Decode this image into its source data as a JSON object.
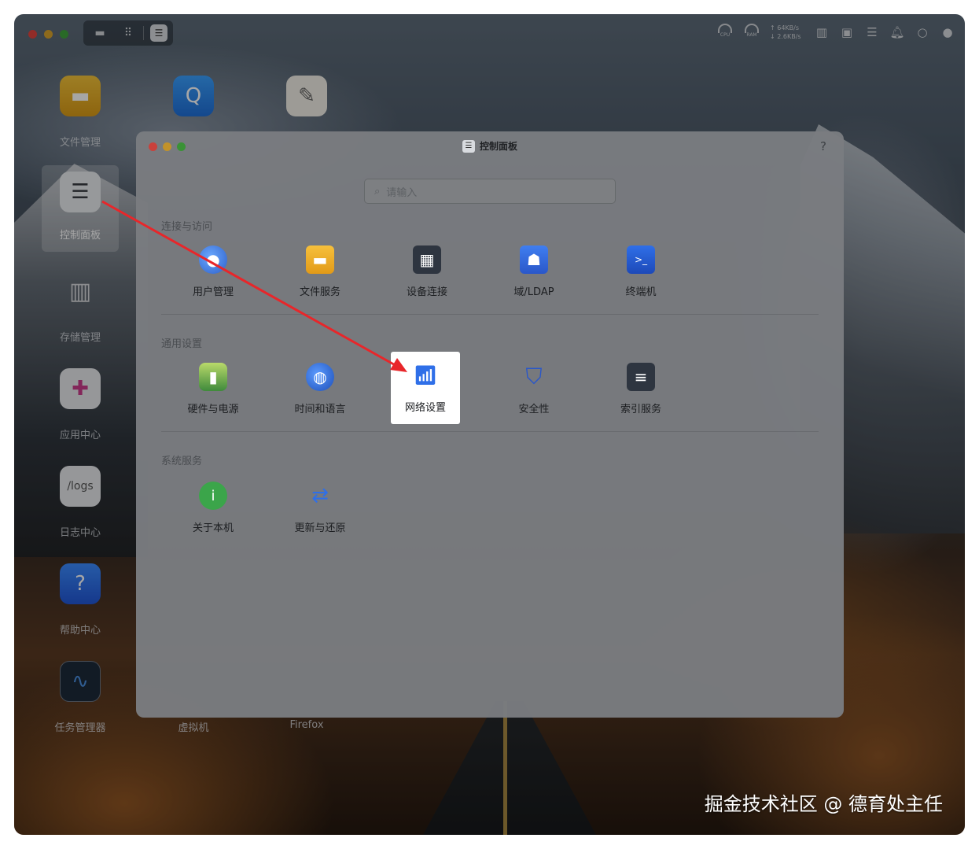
{
  "topbar": {
    "cpu_label": "CPU",
    "ram_label": "RAM",
    "upload": "↑ 64KB/s",
    "download": "↓ 2.6KB/s"
  },
  "desktop": {
    "icons": [
      {
        "label": "文件管理"
      },
      {
        "label": "控制面板"
      },
      {
        "label": "存储管理"
      },
      {
        "label": "应用中心"
      },
      {
        "label": "日志中心"
      },
      {
        "label": "帮助中心"
      },
      {
        "label": "任务管理器"
      },
      {
        "label": "虚拟机"
      },
      {
        "label": "Firefox"
      }
    ],
    "logs_tile_text": "/logs"
  },
  "window": {
    "title": "控制面板",
    "help": "?",
    "search_placeholder": "请输入",
    "sections": [
      {
        "title": "连接与访问",
        "items": [
          {
            "label": "用户管理"
          },
          {
            "label": "文件服务"
          },
          {
            "label": "设备连接"
          },
          {
            "label": "域/LDAP"
          },
          {
            "label": "终端机"
          }
        ]
      },
      {
        "title": "通用设置",
        "items": [
          {
            "label": "硬件与电源"
          },
          {
            "label": "时间和语言"
          },
          {
            "label": "网络设置"
          },
          {
            "label": "安全性"
          },
          {
            "label": "索引服务"
          }
        ]
      },
      {
        "title": "系统服务",
        "items": [
          {
            "label": "关于本机"
          },
          {
            "label": "更新与还原"
          }
        ]
      }
    ]
  },
  "colors": {
    "annotation_arrow": "#e8262a",
    "highlight_bg": "#ffffff"
  },
  "watermark": "掘金技术社区 @ 德育处主任"
}
